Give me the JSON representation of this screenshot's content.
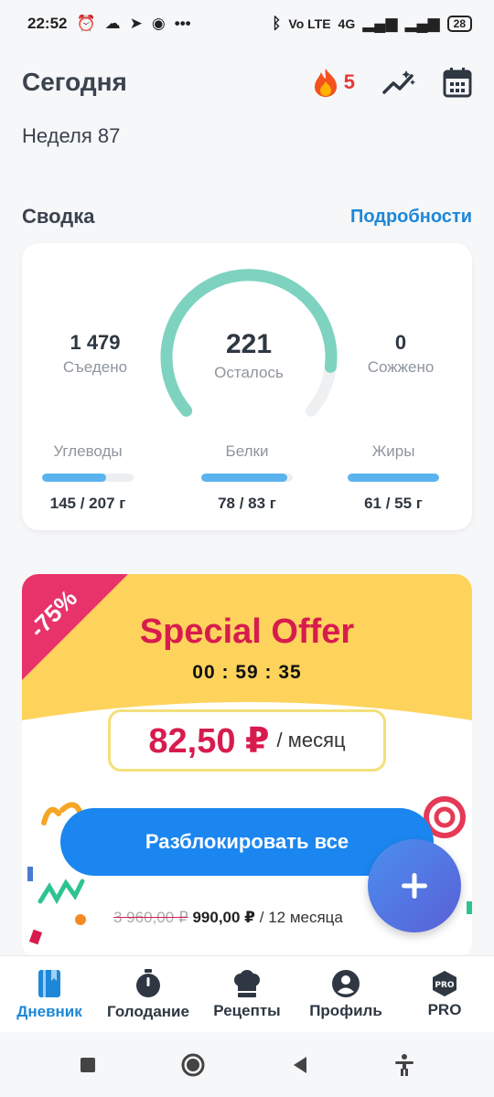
{
  "status_bar": {
    "time": "22:52",
    "network": "4G",
    "volte": "Vo LTE",
    "battery": "28"
  },
  "header": {
    "title": "Сегодня",
    "streak": "5",
    "week": "Неделя 87"
  },
  "summary": {
    "title": "Сводка",
    "details_link": "Подробности",
    "eaten": {
      "value": "1 479",
      "label": "Съедено"
    },
    "remaining": {
      "value": "221",
      "label": "Осталось"
    },
    "burned": {
      "value": "0",
      "label": "Сожжено"
    },
    "macros": [
      {
        "name": "Углеводы",
        "value": "145 / 207 г",
        "fill": 0.7
      },
      {
        "name": "Белки",
        "value": "78 / 83 г",
        "fill": 0.94
      },
      {
        "name": "Жиры",
        "value": "61 / 55 г",
        "fill": 1.0
      }
    ],
    "gauge_fill": 0.87
  },
  "offer": {
    "discount": "-75%",
    "title": "Special Offer",
    "timer": "00 : 59 : 35",
    "price": "82,50 ₽",
    "price_unit": "/ месяц",
    "unlock_button": "Разблокировать все",
    "old_price": "3 960,00 ₽",
    "new_price": "990,00 ₽",
    "period": "/ 12 месяца"
  },
  "nav": [
    {
      "label": "Дневник",
      "icon": "diary-icon",
      "active": true
    },
    {
      "label": "Голодание",
      "icon": "timer-icon",
      "active": false
    },
    {
      "label": "Рецепты",
      "icon": "chef-hat-icon",
      "active": false
    },
    {
      "label": "Профиль",
      "icon": "profile-icon",
      "active": false
    },
    {
      "label": "PRO",
      "icon": "pro-icon",
      "active": false
    }
  ],
  "colors": {
    "accent": "#1e88d8",
    "gauge": "#7dd3c0",
    "offer_bg": "#fdd35c",
    "offer_red": "#d81b4e",
    "button": "#1b86f0"
  }
}
